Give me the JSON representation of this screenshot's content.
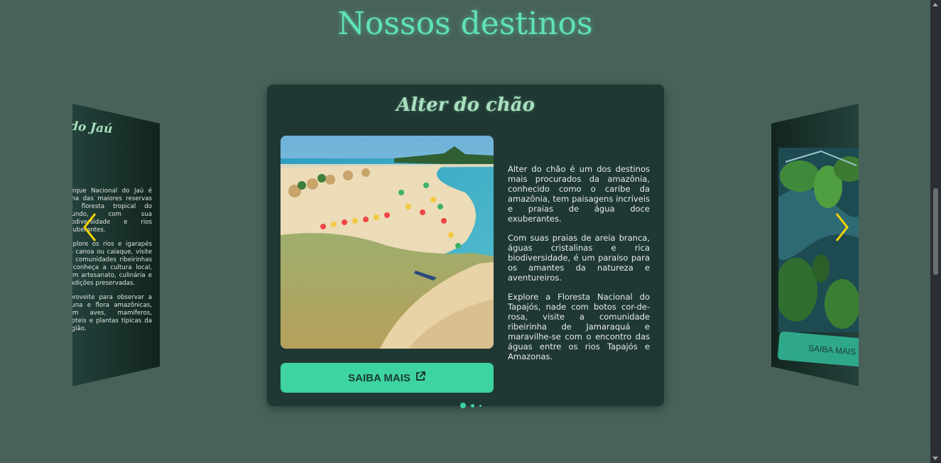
{
  "page": {
    "title": "Nossos destinos"
  },
  "carousel": {
    "active": {
      "title": "Alter do chão",
      "paragraphs": [
        "Alter do chão é um dos destinos mais procurados da amazônia, conhecido como o caribe da amazônia, tem paisagens incríveis e praias de água doce exuberantes.",
        "Com suas praias de areia branca, águas cristalinas e rica biodiversidade, é um paraíso para os amantes da natureza e aventureiros.",
        "Explore a Floresta Nacional do Tapajós, nade com botos cor-de-rosa, visite a comunidade ribeirinha de Jamaraquá e maravilhe-se com o encontro das águas entre os rios Tapajós e Amazonas."
      ],
      "button_label": "SAIBA MAIS",
      "button_icon": "external-link-icon"
    },
    "previous": {
      "title": "do Jaú",
      "paragraphs": [
        "Parque Nacional do Jaú é uma das maiores reservas de floresta tropical do mundo, com sua biodiversidade e rios exuberantes.",
        "Explore os rios e igarapés de canoa ou caiaque, visite as comunidades ribeirinhas e conheça a cultura local, com artesanato, culinária e tradições preservadas.",
        "Aproveite para observar a fauna e flora amazônicas, com aves, mamíferos, répteis e plantas típicas da região."
      ]
    },
    "next": {
      "button_label": "SAIBA MAIS"
    },
    "nav": {
      "prev_icon": "chevron-left-icon",
      "next_icon": "chevron-right-icon",
      "arrow_color": "#f5d400"
    },
    "pagination": {
      "count": 3,
      "active_index": 0
    }
  },
  "colors": {
    "background": "#48625a",
    "accent": "#3dd4a2",
    "card": "#1f3834",
    "title": "#5fe3b4"
  }
}
